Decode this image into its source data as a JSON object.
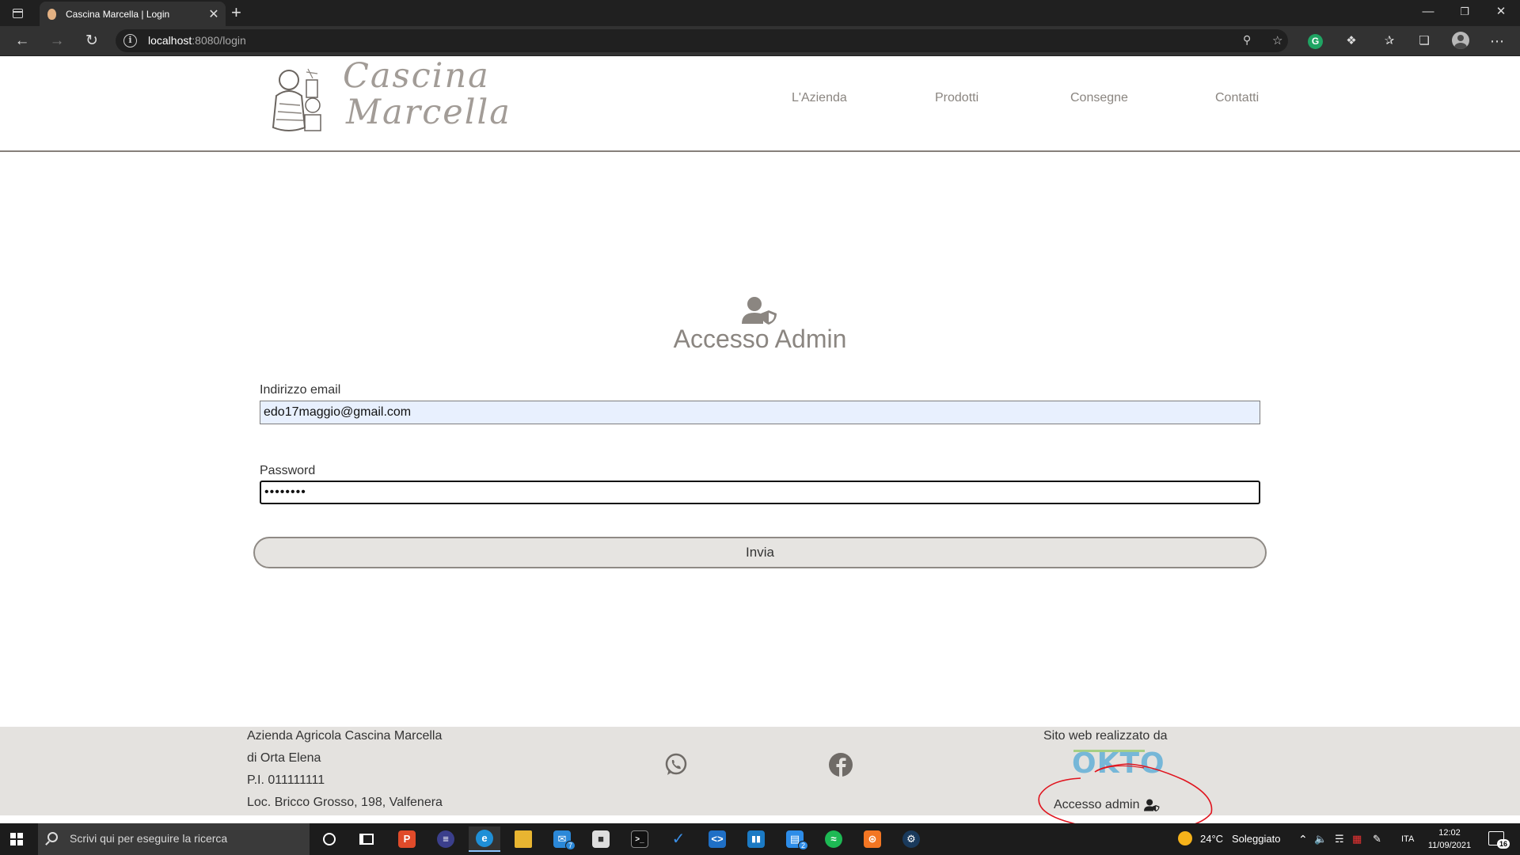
{
  "browser": {
    "tab_title": "Cascina Marcella | Login",
    "url_host": "localhost",
    "url_rest": ":8080/login",
    "new_tab_symbol": "+",
    "close_symbol": "✕"
  },
  "site": {
    "logo_line1": "Cascina",
    "logo_line2": "Marcella",
    "nav": [
      {
        "label": "L'Azienda"
      },
      {
        "label": "Prodotti"
      },
      {
        "label": "Consegne"
      },
      {
        "label": "Contatti"
      }
    ]
  },
  "login": {
    "title": "Accesso Admin",
    "email_label": "Indirizzo email",
    "email_value": "edo17maggio@gmail.com",
    "password_label": "Password",
    "password_value": "••••••••",
    "submit_label": "Invia"
  },
  "footer": {
    "lines": [
      "Azienda Agricola Cascina Marcella",
      "di Orta Elena",
      "P.I. 011111111",
      "Loc. Bricco Grosso, 198, Valfenera"
    ],
    "credit": "Sito web realizzato da",
    "credit_logo": "OKTO",
    "admin_link": "Accesso admin",
    "social": [
      "whatsapp-icon",
      "facebook-icon"
    ]
  },
  "taskbar": {
    "search_placeholder": "Scrivi qui per eseguire la ricerca",
    "weather_temp": "24°C",
    "weather_text": "Soleggiato",
    "language": "ITA",
    "time": "12:02",
    "date": "11/09/2021",
    "notification_count": "16",
    "mail_badge": "7",
    "app_badge": "2"
  },
  "colors": {
    "accent_text": "#8b8681",
    "footer_bg": "#e4e2df",
    "email_autofill_bg": "#e8f0fe",
    "annotation_red": "#e0141e"
  }
}
